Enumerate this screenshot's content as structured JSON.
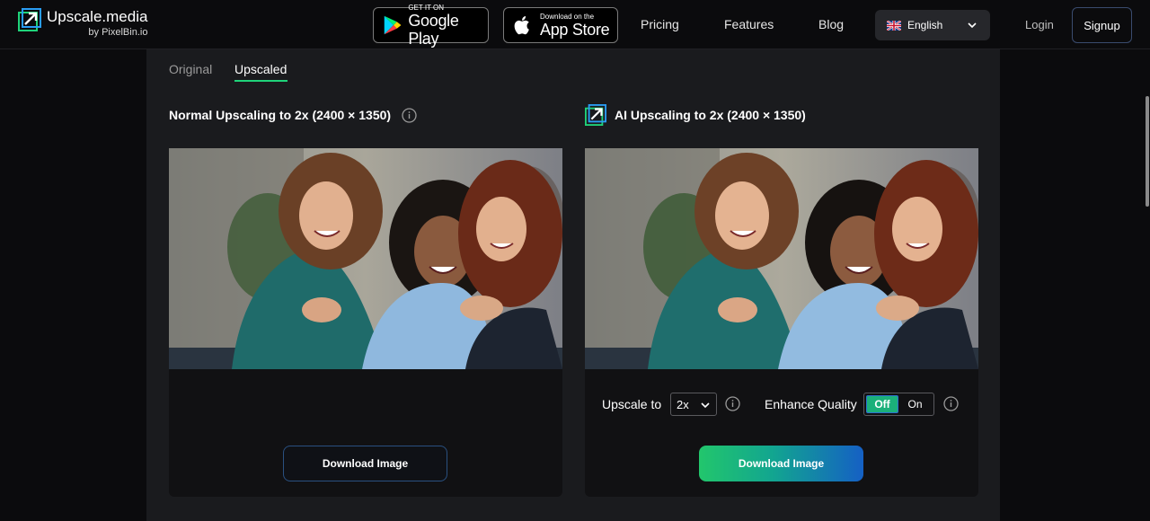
{
  "header": {
    "logo_title": "Upscale.media",
    "logo_sub": "by PixelBin.io",
    "google_play": {
      "small": "GET IT ON",
      "big": "Google Play"
    },
    "app_store": {
      "small": "Download on the",
      "big": "App Store"
    },
    "nav": [
      "Pricing",
      "Features",
      "Blog"
    ],
    "language": "English",
    "login": "Login",
    "signup": "Signup"
  },
  "tabs": {
    "original": "Original",
    "upscaled": "Upscaled",
    "active": "Upscaled"
  },
  "normal": {
    "title": "Normal Upscaling to 2x (2400 × 1350)",
    "download": "Download Image"
  },
  "ai": {
    "title": "AI Upscaling to 2x (2400 × 1350)",
    "upscale_label": "Upscale to",
    "upscale_value": "2x",
    "enhance_label": "Enhance Quality",
    "toggle_off": "Off",
    "toggle_on": "On",
    "toggle_state": "Off",
    "download": "Download Image"
  },
  "colors": {
    "accent_green": "#1fd37a",
    "gradient_start": "#22c66c",
    "gradient_end": "#1560c4",
    "panel_bg": "#1a1b1e"
  },
  "icons": [
    "upscale-logo-icon",
    "google-play-icon",
    "apple-icon",
    "uk-flag-icon",
    "chevron-down-icon",
    "info-icon"
  ]
}
